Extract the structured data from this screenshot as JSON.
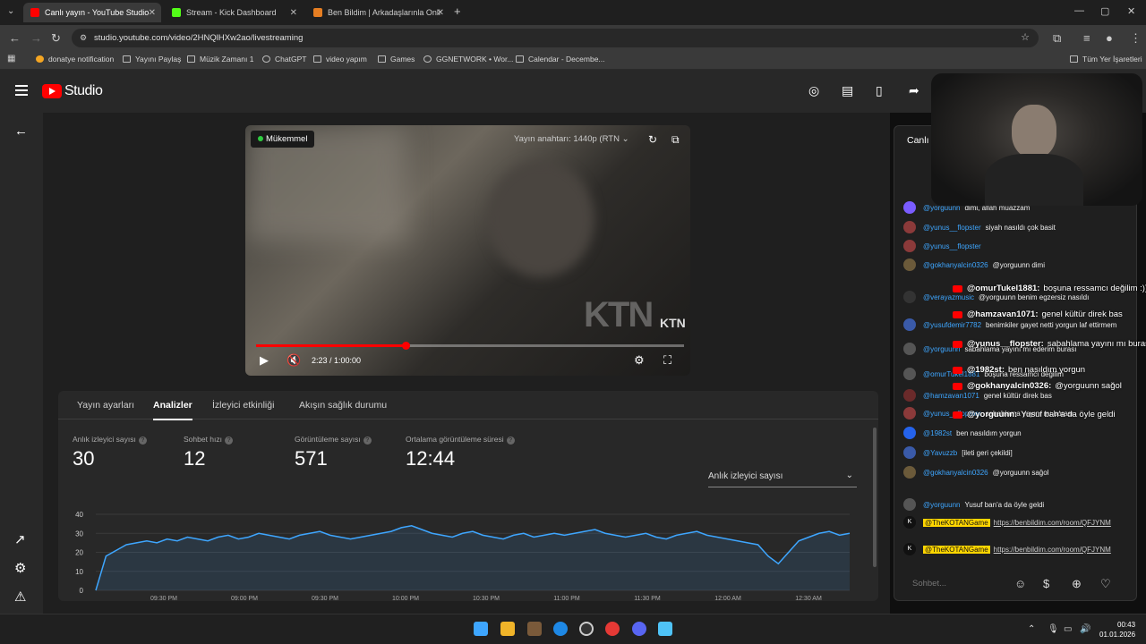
{
  "browser": {
    "tabs": [
      {
        "title": "Canlı yayın - YouTube Studio",
        "color": "#ff0000"
      },
      {
        "title": "Stream - Kick Dashboard",
        "color": "#53fc18"
      },
      {
        "title": "Ben Bildim | Arkadaşlarınla Onli",
        "color": "#e67e22"
      }
    ],
    "url": "studio.youtube.com/video/2HNQlHXw2ao/livestreaming",
    "bookmarks": [
      "donatye notification",
      "Yayını Paylaş",
      "Müzik Zamanı 1",
      "ChatGPT",
      "video yapım",
      "Games",
      "GGNETWORK • Wor...",
      "Calendar - Decembe..."
    ],
    "all_bookmarks": "Tüm Yer İşaretleri"
  },
  "studio": {
    "logo": "Studio"
  },
  "video": {
    "quality_badge": "Mükemmel",
    "stream_key": "Yayın anahtarı: 1440p (RTN",
    "time": "2:23 / 1:00:00",
    "watermark": "KTN",
    "progress_fraction": 0.35
  },
  "analytics": {
    "tabs": [
      "Yayın ayarları",
      "Analizler",
      "İzleyici etkinliği",
      "Akışın sağlık durumu"
    ],
    "metrics": [
      {
        "label": "Anlık izleyici sayısı",
        "value": "30"
      },
      {
        "label": "Sohbet hızı",
        "value": "12"
      },
      {
        "label": "Görüntüleme sayısı",
        "value": "571"
      },
      {
        "label": "Ortalama görüntüleme süresi",
        "value": "12:44"
      }
    ],
    "dropdown": "Anlık izleyici sayısı"
  },
  "chart_data": {
    "type": "line",
    "ylim": [
      0,
      40
    ],
    "yticks": [
      "40",
      "30",
      "20",
      "10",
      "0"
    ],
    "xticks": [
      "09:30 PM",
      "09:00 PM",
      "09:30 PM",
      "10:00 PM",
      "10:30 PM",
      "11:00 PM",
      "11:30 PM",
      "12:00 AM",
      "12:30 AM"
    ],
    "values": [
      0,
      18,
      21,
      24,
      25,
      26,
      25,
      27,
      26,
      28,
      27,
      26,
      28,
      29,
      27,
      28,
      30,
      29,
      28,
      27,
      29,
      30,
      31,
      29,
      28,
      27,
      28,
      29,
      30,
      31,
      33,
      34,
      32,
      30,
      29,
      28,
      30,
      31,
      29,
      28,
      27,
      29,
      30,
      28,
      29,
      30,
      29,
      30,
      31,
      32,
      30,
      29,
      28,
      29,
      30,
      28,
      27,
      29,
      30,
      31,
      29,
      28,
      27,
      26,
      25,
      24,
      18,
      14,
      20,
      26,
      28,
      30,
      31,
      29,
      30
    ],
    "color": "#3ea6ff"
  },
  "chat": {
    "title": "Canlı s",
    "lines": [
      {
        "user": "@yorguunn",
        "msg": "dimi, allah muazzam",
        "color": "#7a5cff"
      },
      {
        "user": "@yunus__flopster",
        "msg": "siyah nasıldı çok basit",
        "color": "#8b3a3a"
      },
      {
        "user": "@yunus__flopster",
        "msg": "",
        "color": "#8b3a3a"
      },
      {
        "user": "@gokhanyalcin0326",
        "msg": "@yorguunn dimi",
        "color": "#6b5a3a"
      },
      {
        "user": "@verayazmusic",
        "msg": "@yorguunn benim egzersiz nasıldı",
        "color": "#333"
      },
      {
        "user": "@yusufdemir7782",
        "msg": "benimkiler gayet netti yorgun laf ettirmem",
        "color": "#3a5aa8"
      },
      {
        "user": "@yorguunn",
        "msg": "sabahlama yayını mı ederim burası",
        "color": "#555"
      },
      {
        "user": "@omurTukel1881",
        "msg": "boşuna ressamcı değilim",
        "color": "#555"
      },
      {
        "user": "@hamzavan1071",
        "msg": "genel kültür direk bas",
        "color": "#6a2a2a"
      },
      {
        "user": "@yunus__flopster",
        "msg": "sabahlama yayını mı burası",
        "color": "#8b3a3a"
      },
      {
        "user": "@1982st",
        "msg": "ben nasıldım yorgun",
        "color": "#2563eb"
      },
      {
        "user": "@Yavuzzb",
        "msg": "[ileti geri çekildi]",
        "color": "#3a5aa8"
      },
      {
        "user": "@gokhanyalcin0326",
        "msg": "@yorguunn sağol",
        "color": "#6b5a3a"
      },
      {
        "user": "@yorguunn",
        "msg": "Yusuf ban'a da öyle geldi",
        "color": "#555"
      }
    ],
    "bot_messages": [
      {
        "mention": "@TheKOTANGame",
        "link": "https://benbildim.com/room/QFJYNM"
      },
      {
        "mention": "@TheKOTANGame",
        "link": "https://benbildim.com/room/QFJYNM"
      }
    ],
    "overlay": [
      {
        "user": "@omurTukel1881:",
        "msg": "boşuna ressamcı değilim :))))"
      },
      {
        "user": "@hamzavan1071:",
        "msg": "genel kültür direk bas"
      },
      {
        "user": "@yunus__flopster:",
        "msg": "sabahlama yayını mı burası"
      },
      {
        "user": "@1982st:",
        "msg": "ben nasıldım yorgun"
      },
      {
        "user": "@gokhanyalcin0326:",
        "msg": "@yorguunn sağol"
      },
      {
        "user": "@yorguunn:",
        "msg": "Yusuf ban'a da öyle geldi"
      }
    ],
    "input_placeholder": "Sohbet..."
  },
  "taskbar": {
    "time": "00:43",
    "date": "01.01.2026"
  }
}
